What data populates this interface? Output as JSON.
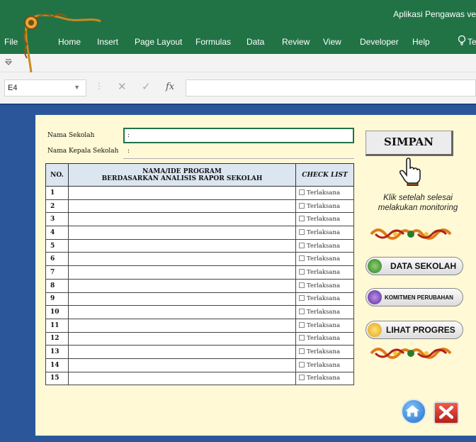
{
  "window": {
    "title": "Aplikasi Pengawas ve"
  },
  "ribbon": {
    "tabs": [
      "File",
      "Home",
      "Insert",
      "Page Layout",
      "Formulas",
      "Data",
      "Review",
      "View",
      "Developer",
      "Help"
    ],
    "tell_me": "Tel"
  },
  "formula_bar": {
    "name_box": "E4",
    "fx_label": "fx",
    "formula": ""
  },
  "form": {
    "nama_sekolah_label": "Nama Sekolah",
    "nama_kepala_label": "Nama Kepala Sekolah",
    "colon": ":",
    "table": {
      "headers": {
        "no": "NO.",
        "program_line1": "NAMA/IDE PROGRAM",
        "program_line2": "BERDASARKAN ANALISIS RAPOR SEKOLAH",
        "check": "CHECK LIST"
      },
      "rows": [
        {
          "no": "1",
          "check": "Terlaksana"
        },
        {
          "no": "2",
          "check": "Terlaksana"
        },
        {
          "no": "3",
          "check": "Terlaksana"
        },
        {
          "no": "4",
          "check": "Terlaksana"
        },
        {
          "no": "5",
          "check": "Terlaksana"
        },
        {
          "no": "6",
          "check": "Terlaksana"
        },
        {
          "no": "7",
          "check": "Terlaksana"
        },
        {
          "no": "8",
          "check": "Terlaksana"
        },
        {
          "no": "9",
          "check": "Terlaksana"
        },
        {
          "no": "10",
          "check": "Terlaksana"
        },
        {
          "no": "11",
          "check": "Terlaksana"
        },
        {
          "no": "12",
          "check": "Terlaksana"
        },
        {
          "no": "13",
          "check": "Terlaksana"
        },
        {
          "no": "14",
          "check": "Terlaksana"
        },
        {
          "no": "15",
          "check": "Terlaksana"
        }
      ]
    }
  },
  "side": {
    "simpan": "SIMPAN",
    "klik_line1": "Klik setelah selesai",
    "klik_line2": "melakukan monitoring",
    "data_sekolah": "DATA SEKOLAH",
    "komitmen": "KOMITMEN PERUBAHAN",
    "lihat_progres": "LIHAT PROGRES"
  },
  "colors": {
    "excel_green": "#217346",
    "sheet_blue": "#2b579a",
    "panel_cream": "#fff9d6",
    "header_blue": "#dce6f1"
  }
}
